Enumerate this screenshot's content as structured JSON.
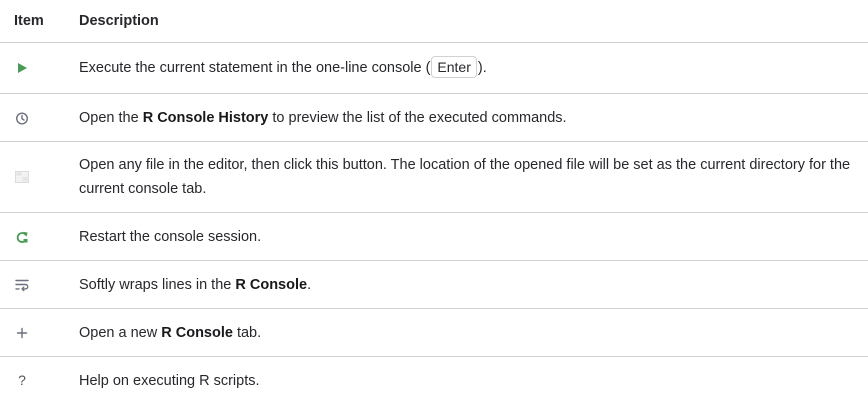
{
  "table": {
    "headers": {
      "item": "Item",
      "description": "Description"
    },
    "rows": [
      {
        "icon": "play-icon",
        "parts": [
          "Execute the current statement in the one-line console (",
          "Enter",
          ")."
        ]
      },
      {
        "icon": "history-clock-icon",
        "parts": [
          "Open the ",
          "R Console History",
          " to preview the list of the executed commands."
        ]
      },
      {
        "icon": "window-icon",
        "parts": [
          "Open any file in the editor, then click this button. The location of the opened file will be set as the current directory for the current console tab."
        ]
      },
      {
        "icon": "restart-icon",
        "parts": [
          "Restart the console session."
        ]
      },
      {
        "icon": "soft-wrap-icon",
        "parts": [
          "Softly wraps lines in the ",
          "R Console",
          "."
        ]
      },
      {
        "icon": "plus-icon",
        "parts": [
          "Open a new ",
          "R Console",
          " tab."
        ]
      },
      {
        "icon": "question-icon",
        "glyph": "?",
        "parts": [
          "Help on executing R scripts."
        ]
      }
    ]
  },
  "colors": {
    "play": "#499c54",
    "restart": "#499c54",
    "icon_gray": "#6c707e",
    "border": "#d1d1d2",
    "text": "#27282c"
  }
}
